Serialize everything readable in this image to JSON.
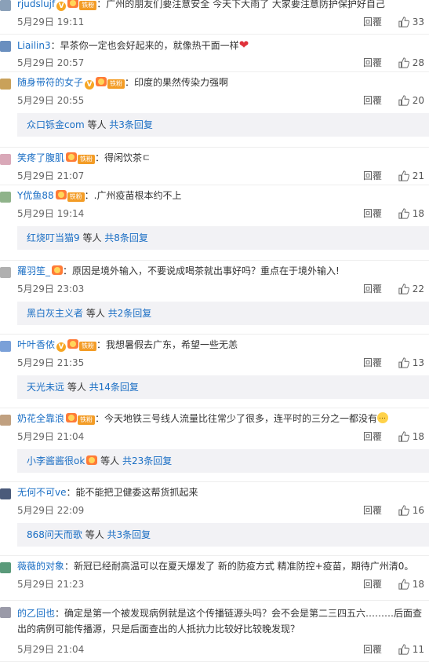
{
  "reply_label": "回覆",
  "thread_mid": "等人",
  "colors": {
    "link": "#1a6ec4",
    "thread_bg": "#f2f2f5",
    "divider": "#eeeeee"
  },
  "comments": [
    {
      "user": "rjudslujf",
      "badges": [
        "v",
        "medal",
        "fan"
      ],
      "text": "广州的朋友们要注意安全 今天下大雨了 大家要注意防护保护好自己",
      "date": "5月29日 19:11",
      "likes": "33",
      "avatar": "#8aa0b8"
    },
    {
      "user": "Liailin3",
      "badges": [],
      "text": "早茶你一定也会好起来的，就像热干面一样",
      "emoji": "heart",
      "date": "5月29日 20:57",
      "likes": "28",
      "avatar": "#6a8fbf"
    },
    {
      "user": "随身带符的女子",
      "badges": [
        "v",
        "medal",
        "fan"
      ],
      "text": "印度的果然传染力强啊",
      "date": "5月29日 20:55",
      "likes": "20",
      "avatar": "#c9a15a",
      "thread": {
        "user": "众口铄金com",
        "count": "共3条回复"
      }
    },
    {
      "user": "笑疼了腹肌",
      "badges": [
        "medal",
        "fan"
      ],
      "text": "得闲饮茶ㄷ",
      "date": "5月29日 21:07",
      "likes": "21",
      "avatar": "#d9a8b8"
    },
    {
      "user": "Y优鱼88",
      "badges": [
        "medal",
        "fan"
      ],
      "text": ".广州疫苗根本约不上",
      "date": "5月29日 19:14",
      "likes": "18",
      "avatar": "#8fb38a",
      "thread": {
        "user": "红烧叮当猫9",
        "count": "共8条回复"
      }
    },
    {
      "user": "羅羽笙_",
      "badges": [
        "medal"
      ],
      "text": "原因是境外输入，不要说成喝茶就出事好吗？重点在于境外输入!",
      "date": "5月29日 23:03",
      "likes": "22",
      "avatar": "#b0b0b0",
      "thread": {
        "user": "黑白灰主义者",
        "count": "共2条回复"
      }
    },
    {
      "user": "叶叶香侬",
      "badges": [
        "v",
        "medal",
        "fan"
      ],
      "text": "我想暑假去广东，希望一些无恙",
      "date": "5月29日 21:35",
      "likes": "13",
      "avatar": "#7aa0d8",
      "thread": {
        "user": "天光未远",
        "count": "共14条回复"
      }
    },
    {
      "user": "奶花全靠浪",
      "badges": [
        "medal",
        "fan"
      ],
      "text": "今天地铁三号线人流量比往常少了很多，连平时的三分之一都没有",
      "emoji": "face",
      "date": "5月29日 21:04",
      "likes": "18",
      "avatar": "#c0a080",
      "thread": {
        "user": "小李酱酱很ok",
        "user_medal": true,
        "count": "共23条回复"
      }
    },
    {
      "user": "无何不可ve",
      "badges": [],
      "text": "能不能把卫健委这帮货抓起来",
      "date": "5月29日 22:09",
      "likes": "16",
      "avatar": "#4a5a7a",
      "thread": {
        "user": "868问天而歌",
        "count": "共3条回复"
      }
    },
    {
      "user": "薇薇的对象",
      "badges": [],
      "text": "新冠已经耐高温可以在夏天爆发了 新的防疫方式 精准防控+疫苗，期待广州清0。",
      "date": "5月29日 21:23",
      "likes": "18",
      "avatar": "#5a9a7a"
    },
    {
      "user": "的乙回也",
      "badges": [],
      "text": "确定是第一个被发现病例就是这个传播链源头吗？会不会是第二三四五六………后面查出的病例可能传播源，只是后面查出的人抵抗力比较好比较晚发现？",
      "date": "5月29日 21:04",
      "likes": "11",
      "avatar": "#9a9aa8",
      "multiline": true
    }
  ]
}
